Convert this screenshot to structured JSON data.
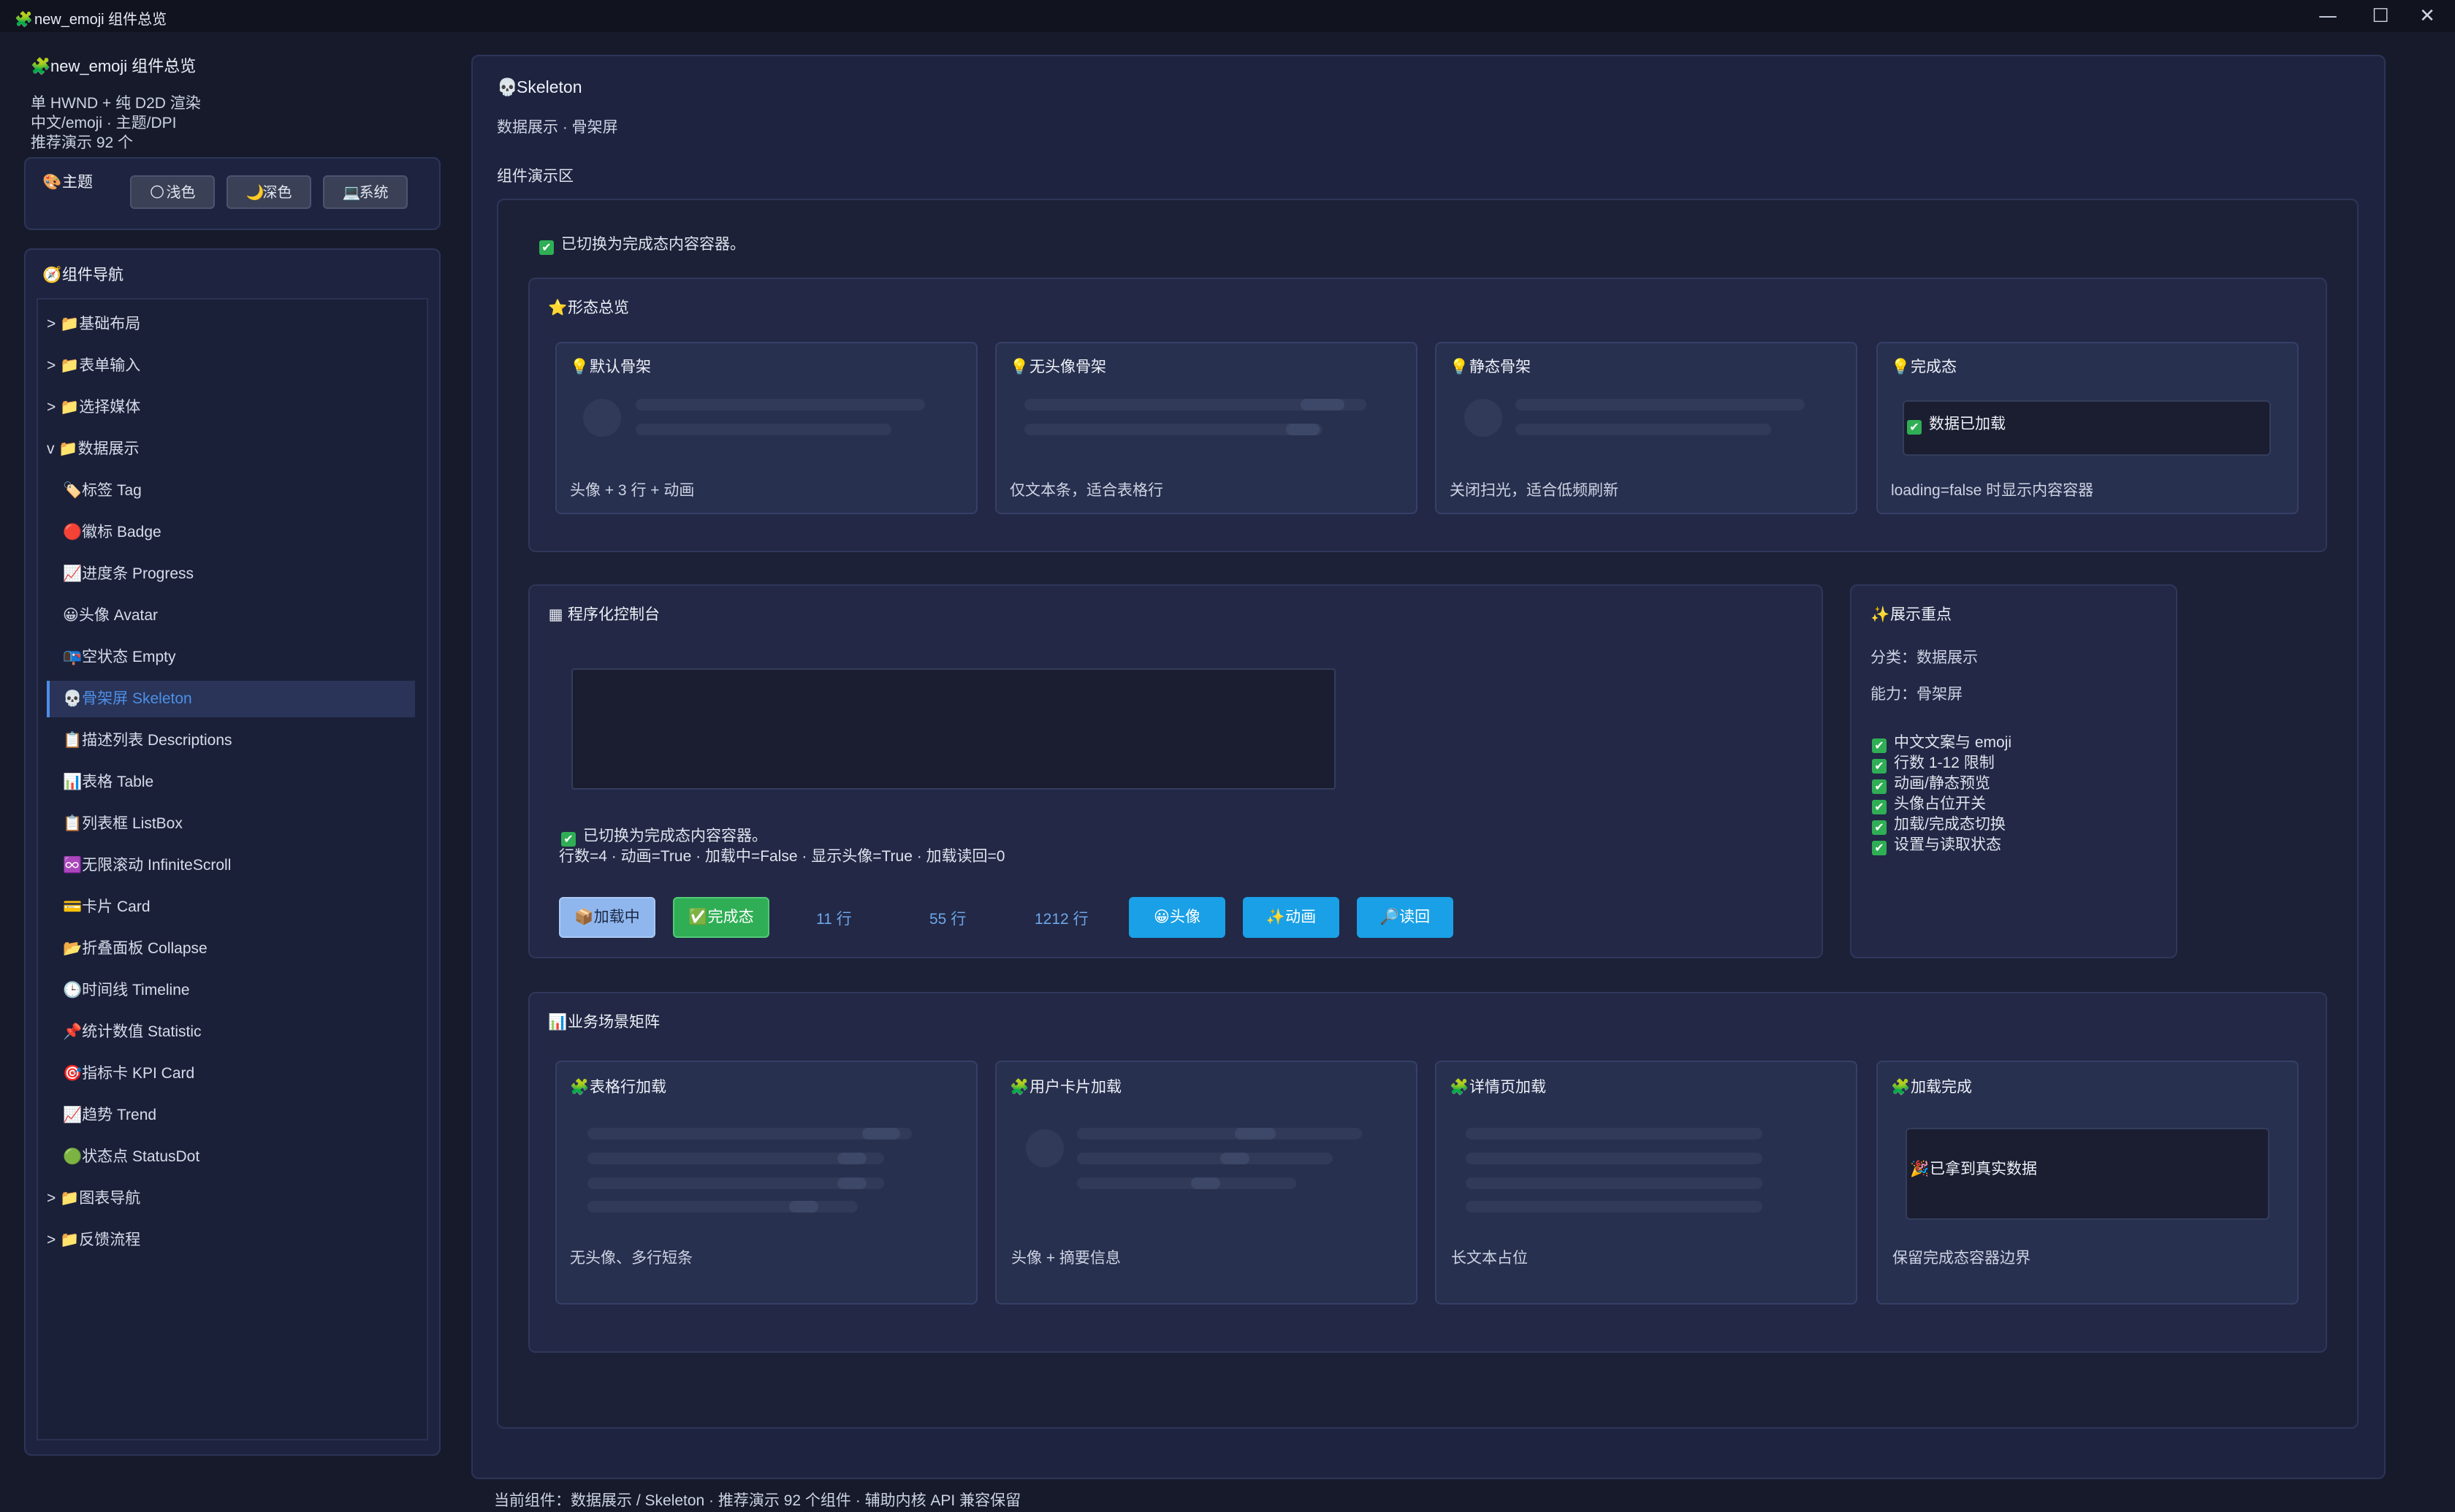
{
  "window": {
    "title": "new_emoji 组件总览",
    "controls": {
      "minimize": "—",
      "maximize": "☐",
      "close": "✕"
    }
  },
  "sidebar": {
    "app_title": "new_emoji 组件总览",
    "info": [
      "单 HWND + 纯 D2D 渲染",
      "中文/emoji · 主题/DPI",
      "推荐演示 92 个"
    ],
    "theme": {
      "label": "主题",
      "options": [
        "浅色",
        "深色",
        "系统"
      ]
    },
    "nav": {
      "title": "组件导航",
      "items": [
        {
          "label": "> 📁基础布局",
          "level": 0
        },
        {
          "label": "> 📁表单输入",
          "level": 0
        },
        {
          "label": "> 📁选择媒体",
          "level": 0
        },
        {
          "label": "v 📁数据展示",
          "level": 0
        },
        {
          "label": "🏷️标签 Tag",
          "level": 1
        },
        {
          "label": "🔴徽标 Badge",
          "level": 1
        },
        {
          "label": "📈进度条 Progress",
          "level": 1
        },
        {
          "label": "😀头像 Avatar",
          "level": 1
        },
        {
          "label": "📭空状态 Empty",
          "level": 1
        },
        {
          "label": "💀骨架屏 Skeleton",
          "level": 1,
          "active": true
        },
        {
          "label": "📋描述列表 Descriptions",
          "level": 1
        },
        {
          "label": "📊表格 Table",
          "level": 1
        },
        {
          "label": "📋列表框 ListBox",
          "level": 1
        },
        {
          "label": "♾️无限滚动 InfiniteScroll",
          "level": 1
        },
        {
          "label": "💳卡片 Card",
          "level": 1
        },
        {
          "label": "📂折叠面板 Collapse",
          "level": 1
        },
        {
          "label": "🕒时间线 Timeline",
          "level": 1
        },
        {
          "label": "📌统计数值 Statistic",
          "level": 1
        },
        {
          "label": "🎯指标卡 KPI Card",
          "level": 1
        },
        {
          "label": "📈趋势 Trend",
          "level": 1
        },
        {
          "label": "🟢状态点 StatusDot",
          "level": 1
        },
        {
          "label": "> 📁图表导航",
          "level": 0
        },
        {
          "label": "> 📁反馈流程",
          "level": 0
        }
      ]
    }
  },
  "main": {
    "title": "Skeleton",
    "subtitle": "数据展示 · 骨架屏",
    "demo_label": "组件演示区",
    "status": "已切换为完成态内容容器。",
    "overview": {
      "title": "形态总览",
      "cards": [
        {
          "title": "默认骨架",
          "foot": "头像 + 3 行 + 动画"
        },
        {
          "title": "无头像骨架",
          "foot": "仅文本条，适合表格行"
        },
        {
          "title": "静态骨架",
          "foot": "关闭扫光，适合低频刷新"
        },
        {
          "title": "完成态",
          "content": "数据已加载",
          "foot": "loading=false 时显示内容容器"
        }
      ]
    },
    "console": {
      "title": "程序化控制台",
      "status": "已切换为完成态内容容器。",
      "state_line": "行数=4 · 动画=True · 加载中=False · 显示头像=True · 加载读回=0",
      "buttons": {
        "loading": "📦加载中",
        "done": "✅完成态",
        "rows11": "11 行",
        "rows55": "55 行",
        "rows1212": "1212 行",
        "avatar": "😀头像",
        "anim": "✨动画",
        "readback": "🔎读回"
      }
    },
    "focus": {
      "title": "展示重点",
      "category": "分类：数据展示",
      "ability": "能力：骨架屏",
      "points": [
        "中文文案与 emoji",
        "行数 1-12 限制",
        "动画/静态预览",
        "头像占位开关",
        "加载/完成态切换",
        "设置与读取状态"
      ]
    },
    "matrix": {
      "title": "业务场景矩阵",
      "cards": [
        {
          "title": "表格行加载",
          "foot": "无头像、多行短条"
        },
        {
          "title": "用户卡片加载",
          "foot": "头像 + 摘要信息"
        },
        {
          "title": "详情页加载",
          "foot": "长文本占位"
        },
        {
          "title": "加载完成",
          "content": "已拿到真实数据",
          "foot": "保留完成态容器边界"
        }
      ]
    }
  },
  "footer": "当前组件：数据展示 / Skeleton · 推荐演示 92 个组件 · 辅助内核 API 兼容保留",
  "colors": {
    "background": "#161a2b",
    "panel": "#1e2440",
    "accent": "#4d8fe6",
    "success": "#2fae55",
    "button_blue": "#1aa0e6"
  }
}
